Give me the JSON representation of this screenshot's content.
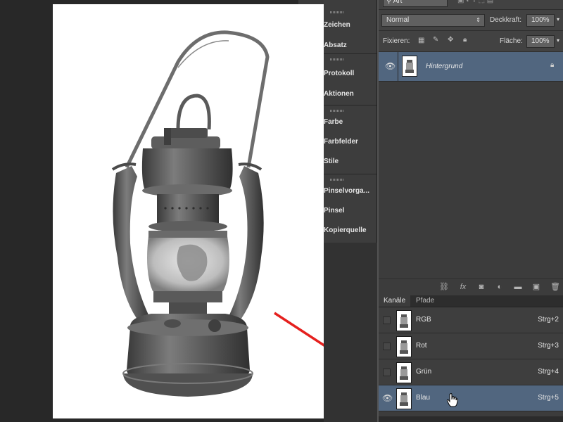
{
  "layers": {
    "filter_kind": "Art",
    "blend_mode": "Normal",
    "opacity_label": "Deckkraft:",
    "opacity_value": "100%",
    "lock_label": "Fixieren:",
    "fill_label": "Fläche:",
    "fill_value": "100%",
    "items": [
      {
        "name": "Hintergrund",
        "visible": true,
        "locked": true
      }
    ]
  },
  "dock": {
    "groups": [
      {
        "items": [
          "Zeichen",
          "Absatz"
        ]
      },
      {
        "items": [
          "Protokoll",
          "Aktionen"
        ]
      },
      {
        "items": [
          "Farbe",
          "Farbfelder",
          "Stile"
        ]
      },
      {
        "items": [
          "Pinselvorga...",
          "Pinsel",
          "Kopierquelle"
        ]
      }
    ]
  },
  "channels": {
    "tabs": [
      "Kanäle",
      "Pfade"
    ],
    "active_tab": "Kanäle",
    "items": [
      {
        "name": "RGB",
        "shortcut": "Strg+2",
        "visible": false,
        "selected": false
      },
      {
        "name": "Rot",
        "shortcut": "Strg+3",
        "visible": false,
        "selected": false
      },
      {
        "name": "Grün",
        "shortcut": "Strg+4",
        "visible": false,
        "selected": false
      },
      {
        "name": "Blau",
        "shortcut": "Strg+5",
        "visible": true,
        "selected": true
      }
    ]
  },
  "colors": {
    "selection": "#51667f",
    "annotation_arrow": "#e5201e"
  }
}
